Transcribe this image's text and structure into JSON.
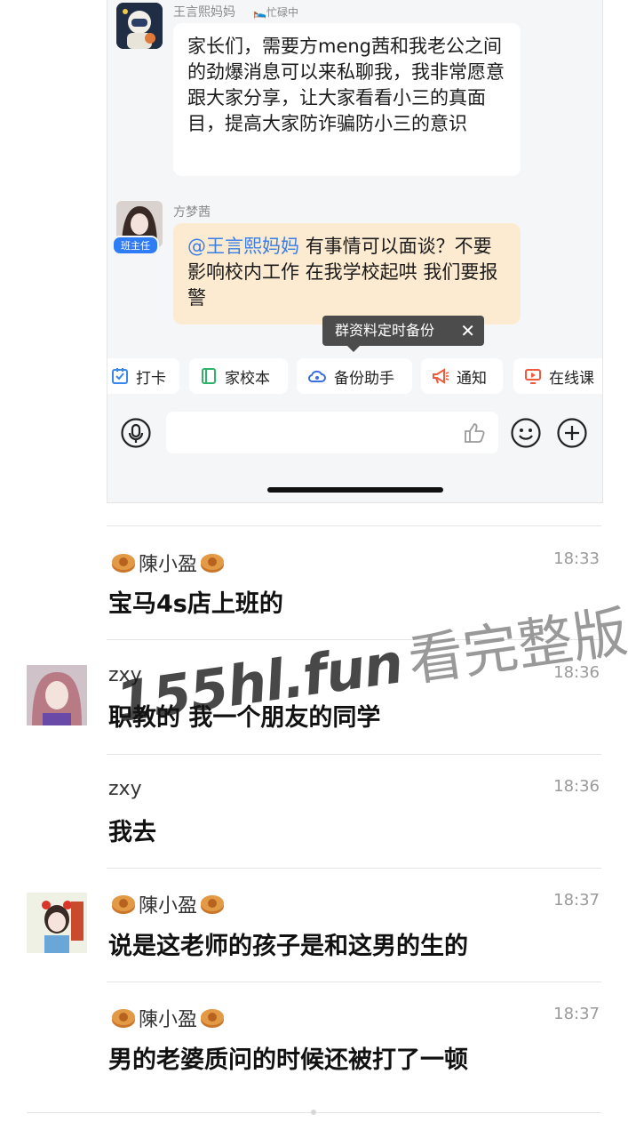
{
  "chat": {
    "messages": [
      {
        "sender": "王言熙妈妈",
        "status": "忙碌中",
        "text": "家长们，需要方meng茜和我老公之间的劲爆消息可以来私聊我，我非常愿意跟大家分享，让大家看看小三的真面目，提高大家防诈骗防小三的意识"
      },
      {
        "sender": "方梦茜",
        "role_badge": "班主任",
        "mention": "@王言熙妈妈",
        "text": "有事情可以面谈？不要影响校内工作 在我学校起哄 我们要报警"
      }
    ],
    "tooltip": {
      "text": "群资料定时备份",
      "close": "✕"
    },
    "quick_actions": [
      {
        "label": "打卡",
        "icon": "checkin-icon",
        "color": "#3a86f0"
      },
      {
        "label": "家校本",
        "icon": "notebook-icon",
        "color": "#2fb36a"
      },
      {
        "label": "备份助手",
        "icon": "cloud-backup-icon",
        "color": "#3a6fe0"
      },
      {
        "label": "通知",
        "icon": "megaphone-icon",
        "color": "#f05a3c"
      },
      {
        "label": "在线课",
        "icon": "online-class-icon",
        "color": "#f05a3c"
      }
    ]
  },
  "comments": [
    {
      "name": "陳小盈",
      "time": "18:33",
      "text": "宝马4s店上班的",
      "decorated": true
    },
    {
      "name": "zxy",
      "time": "18:36",
      "text": "职教的 我一个朋友的同学",
      "decorated": false
    },
    {
      "name": "zxy",
      "time": "18:36",
      "text": "我去",
      "decorated": false
    },
    {
      "name": "陳小盈",
      "time": "18:37",
      "text": "说是这老师的孩子是和这男的生的",
      "decorated": true
    },
    {
      "name": "陳小盈",
      "time": "18:37",
      "text": "男的老婆质问的时候还被打了一顿",
      "decorated": true
    }
  ],
  "watermark": {
    "url": "155hl.fun",
    "text": "看完整版"
  }
}
